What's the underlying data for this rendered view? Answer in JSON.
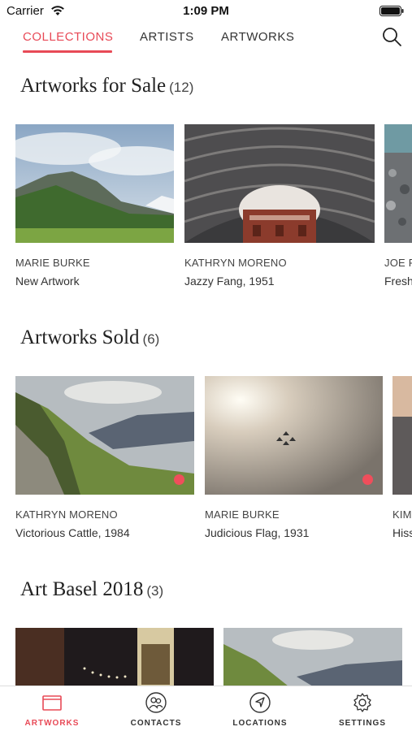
{
  "status_bar": {
    "carrier": "Carrier",
    "time": "1:09 PM"
  },
  "top_tabs": [
    {
      "label": "COLLECTIONS",
      "active": true
    },
    {
      "label": "ARTISTS",
      "active": false
    },
    {
      "label": "ARTWORKS",
      "active": false
    }
  ],
  "sections": [
    {
      "title": "Artworks for Sale",
      "count": "(12)",
      "items": [
        {
          "artist": "MARIE BURKE",
          "artwork": "New Artwork",
          "sold": false
        },
        {
          "artist": "KATHRYN MORENO",
          "artwork": "Jazzy Fang, 1951",
          "sold": false
        },
        {
          "artist": "JOE F",
          "artwork": "Fresh",
          "sold": false
        }
      ]
    },
    {
      "title": "Artworks Sold",
      "count": "(6)",
      "items": [
        {
          "artist": "KATHRYN MORENO",
          "artwork": "Victorious Cattle, 1984",
          "sold": true
        },
        {
          "artist": "MARIE BURKE",
          "artwork": "Judicious Flag, 1931",
          "sold": true
        },
        {
          "artist": "KIM",
          "artwork": "Hiss",
          "sold": false
        }
      ]
    },
    {
      "title": "Art Basel 2018",
      "count": "(3)",
      "items": [
        {
          "artist": "",
          "artwork": ""
        },
        {
          "artist": "",
          "artwork": ""
        }
      ]
    }
  ],
  "bottom_tabs": [
    {
      "label": "ARTWORKS",
      "icon": "artworks-icon",
      "active": true
    },
    {
      "label": "CONTACTS",
      "icon": "contacts-icon",
      "active": false
    },
    {
      "label": "LOCATIONS",
      "icon": "locations-icon",
      "active": false
    },
    {
      "label": "SETTINGS",
      "icon": "settings-icon",
      "active": false
    }
  ],
  "colors": {
    "accent": "#e84a57",
    "sold_dot": "#ef4e5b"
  }
}
